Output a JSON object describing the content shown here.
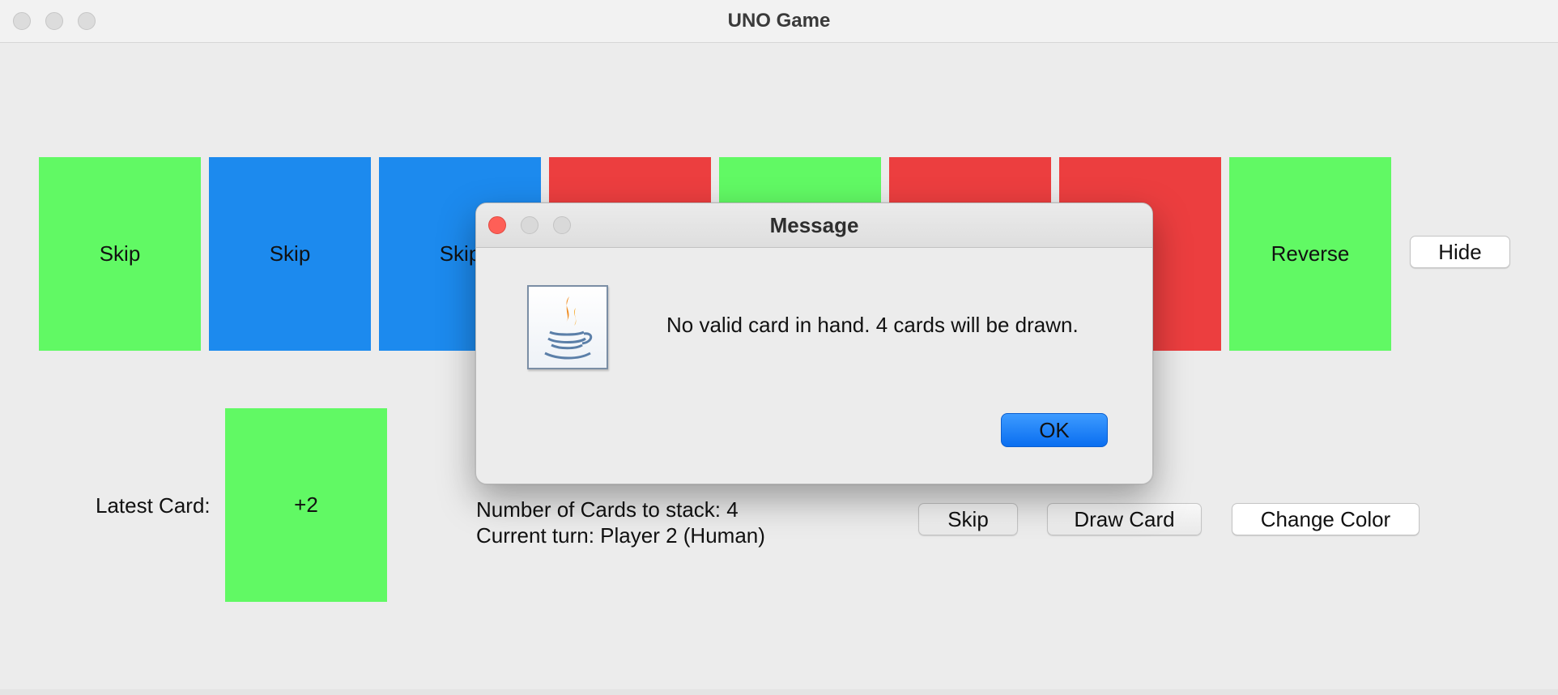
{
  "window": {
    "title": "UNO Game"
  },
  "hand": [
    {
      "label": "Skip",
      "color": "green"
    },
    {
      "label": "Skip",
      "color": "blue"
    },
    {
      "label": "Skip",
      "color": "blue"
    },
    {
      "label": "",
      "color": "red"
    },
    {
      "label": "",
      "color": "green"
    },
    {
      "label": "",
      "color": "red"
    },
    {
      "label": "",
      "color": "red"
    },
    {
      "label": "Reverse",
      "color": "green"
    }
  ],
  "buttons": {
    "hide": "Hide",
    "skip": "Skip",
    "draw_card": "Draw Card",
    "change_color": "Change Color"
  },
  "latest_card": {
    "label": "Latest Card:",
    "value": "+2",
    "color": "green"
  },
  "status": {
    "stack": "Number of Cards to stack: 4",
    "turn": "Current turn: Player 2 (Human)"
  },
  "dialog": {
    "title": "Message",
    "message": "No valid card in hand. 4 cards will be drawn.",
    "ok": "OK",
    "icon": "java-icon"
  },
  "colors": {
    "green": "#61f964",
    "blue": "#1c8aee",
    "red": "#ec3e3f",
    "ok_blue": "#0a6ef0"
  }
}
